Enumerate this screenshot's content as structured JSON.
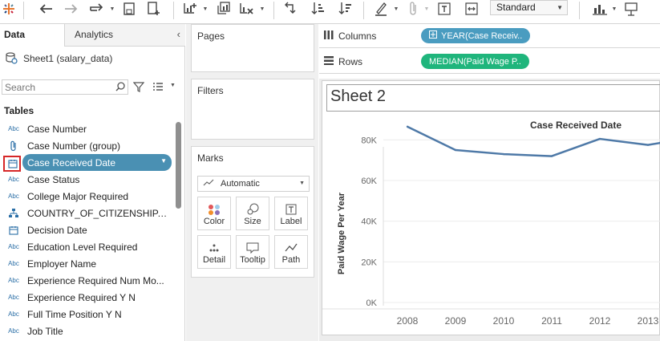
{
  "toolbar": {
    "icons": [
      "tableau-logo-icon",
      "undo-icon",
      "redo-icon",
      "replay-icon",
      "save-icon",
      "new-datasource-icon",
      "new-worksheet-icon",
      "duplicate-sheet-icon",
      "clear-sheet-icon",
      "swap-icon",
      "sort-ascending-icon",
      "sort-descending-icon",
      "highlight-icon",
      "attach-icon",
      "label-text-icon",
      "fit-icon",
      "show-me-icon",
      "presentation-icon"
    ],
    "fit_value": "Standard"
  },
  "left_pane": {
    "tab_data": "Data",
    "tab_analytics": "Analytics",
    "datasource": "Sheet1 (salary_data)",
    "search_placeholder": "Search",
    "tables_header": "Tables",
    "fields": [
      {
        "icon": "Abc",
        "label": "Case Number"
      },
      {
        "icon": "clip",
        "label": "Case Number (group)"
      },
      {
        "icon": "calendar",
        "label": "Case Received Date"
      },
      {
        "icon": "Abc",
        "label": "Case Status"
      },
      {
        "icon": "Abc",
        "label": "College Major Required"
      },
      {
        "icon": "hierarchy",
        "label": "COUNTRY_OF_CITIZENSHIP, ..."
      },
      {
        "icon": "calendar",
        "label": "Decision Date"
      },
      {
        "icon": "Abc",
        "label": "Education Level Required"
      },
      {
        "icon": "Abc",
        "label": "Employer Name"
      },
      {
        "icon": "Abc",
        "label": "Experience Required Num Mo..."
      },
      {
        "icon": "Abc",
        "label": "Experience Required Y N"
      },
      {
        "icon": "Abc",
        "label": "Full Time Position Y N"
      },
      {
        "icon": "Abc",
        "label": "Job Title"
      }
    ],
    "selected_index": 2
  },
  "cards": {
    "pages": "Pages",
    "filters": "Filters",
    "marks": "Marks",
    "marks_type": "Automatic",
    "mark_buttons": [
      "Color",
      "Size",
      "Label",
      "Detail",
      "Tooltip",
      "Path"
    ]
  },
  "shelves": {
    "columns_label": "Columns",
    "rows_label": "Rows",
    "columns_pill": "YEAR(Case Receiv..",
    "rows_pill": "MEDIAN(Paid Wage P..",
    "columns_pill_color": "#4a9cc0",
    "rows_pill_color": "#1fb57c"
  },
  "sheet": {
    "title": "Sheet 2"
  },
  "chart_data": {
    "type": "line",
    "title": "Case Received Date",
    "ylabel": "Paid Wage Per Year",
    "xlabel": "",
    "categories": [
      "2008",
      "2009",
      "2010",
      "2011",
      "2012",
      "2013"
    ],
    "series": [
      {
        "values": [
          86500,
          75000,
          73000,
          72000,
          80500,
          77500
        ]
      }
    ],
    "ylim": [
      0,
      90000
    ],
    "y_ticks": [
      "0K",
      "20K",
      "40K",
      "60K",
      "80K"
    ],
    "y_tick_values": [
      0,
      20000,
      40000,
      60000,
      80000
    ],
    "line_color": "#4e79a7",
    "grid": true
  }
}
